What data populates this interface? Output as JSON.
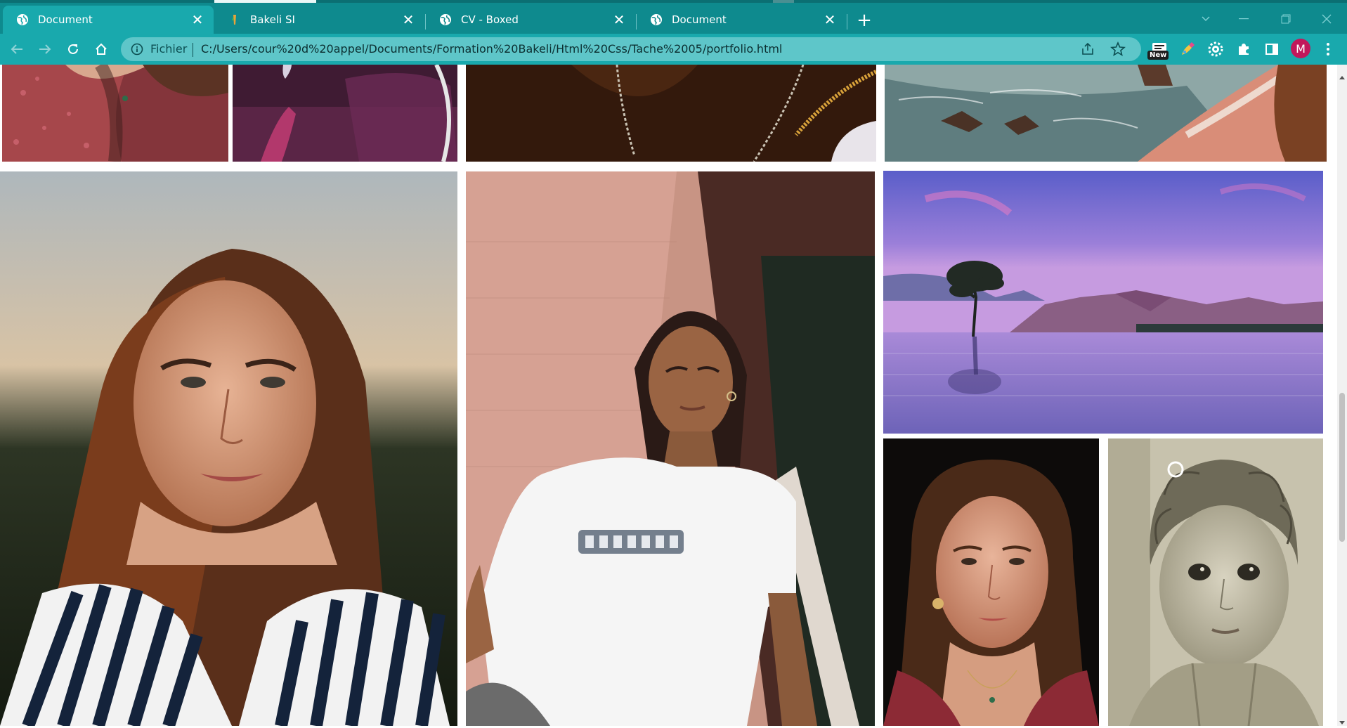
{
  "browser": {
    "tabs": [
      {
        "title": "Document",
        "active": true
      },
      {
        "title": "Bakeli SI",
        "active": false
      },
      {
        "title": "CV - Boxed",
        "active": false
      },
      {
        "title": "Document",
        "active": false
      }
    ],
    "address_scheme": "Fichier",
    "address_url": "C:/Users/cour%20d%20appel/Documents/Formation%20Bakeli/Html%20Css/Tache%2005/portfolio.html",
    "extension_badge": "New",
    "profile_initial": "M",
    "colors": {
      "tabbar": "#0e8a8e",
      "toolbar": "#19a9ad",
      "omnibox": "#5ec6c9",
      "avatar": "#c2185b"
    }
  },
  "gallery": {
    "photos": [
      {
        "name": "woman-red-floral-dress-necklace"
      },
      {
        "name": "hand-holding-feather-purple"
      },
      {
        "name": "dark-skin-necklaces-beads"
      },
      {
        "name": "rocky-coast-sea-waves"
      },
      {
        "name": "woman-striped-shirt-sunset"
      },
      {
        "name": "woman-white-tshirt-pink-wall"
      },
      {
        "name": "lone-tree-lake-purple-sky"
      },
      {
        "name": "woman-portrait-dark-background"
      },
      {
        "name": "child-sepia-portrait"
      }
    ]
  }
}
